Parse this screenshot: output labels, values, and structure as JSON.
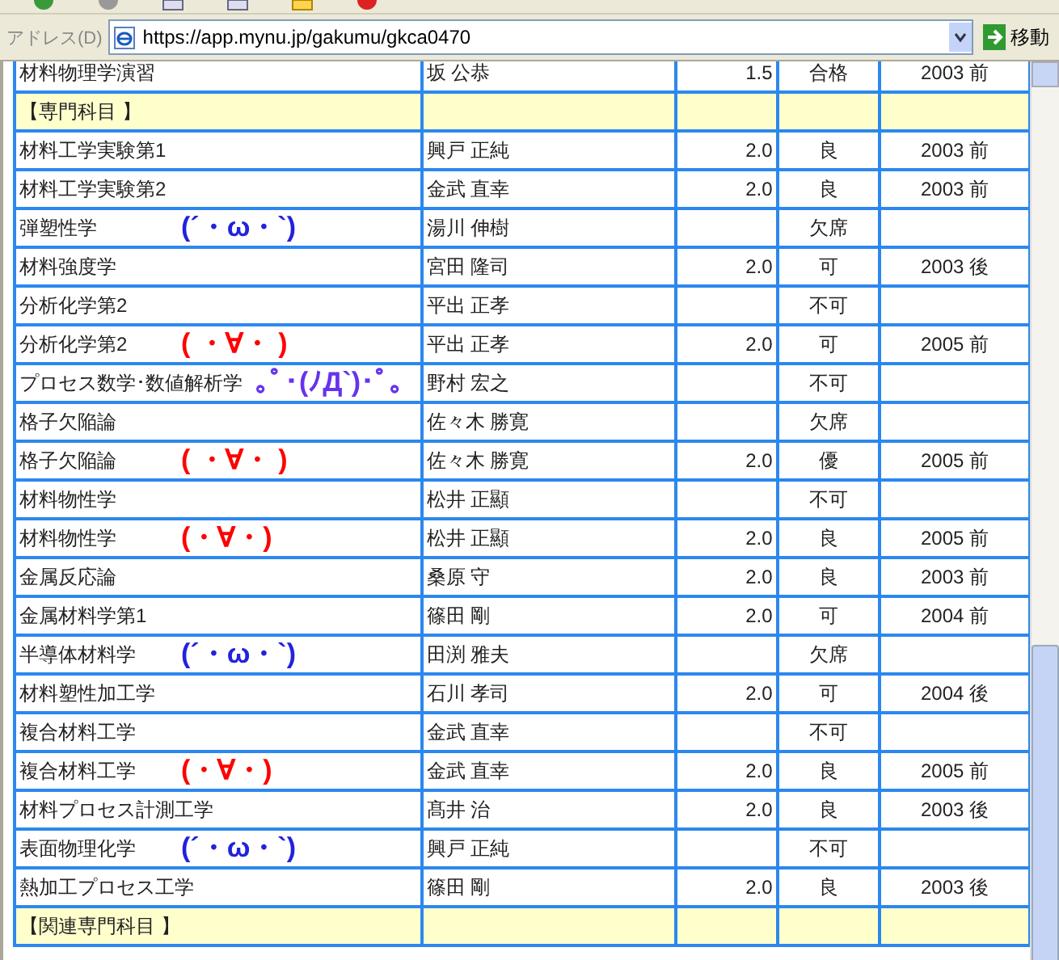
{
  "address_bar": {
    "label": "アドレス(D)",
    "url": "https://app.mynu.jp/gakumu/gkca0470",
    "go_button": "移動"
  },
  "table": {
    "rows": [
      {
        "kind": "course",
        "subject": "材料物理学演習",
        "teacher": "坂 公恭",
        "credits": "1.5",
        "grade": "合格",
        "term": "2003 前"
      },
      {
        "kind": "category",
        "subject": "【専門科目 】"
      },
      {
        "kind": "course",
        "subject": "材料工学実験第1",
        "teacher": "興戸 正純",
        "credits": "2.0",
        "grade": "良",
        "term": "2003 前"
      },
      {
        "kind": "course",
        "subject": "材料工学実験第2",
        "teacher": "金武 直幸",
        "credits": "2.0",
        "grade": "良",
        "term": "2003 前"
      },
      {
        "kind": "course",
        "subject": "弾塑性学",
        "annotation": "(´・ω・`)",
        "color": "#2222dd",
        "teacher": "湯川 伸樹",
        "grade": "欠席"
      },
      {
        "kind": "course",
        "subject": "材料強度学",
        "teacher": "宮田 隆司",
        "credits": "2.0",
        "grade": "可",
        "term": "2003 後"
      },
      {
        "kind": "course",
        "subject": "分析化学第2",
        "teacher": "平出 正孝",
        "grade": "不可"
      },
      {
        "kind": "course",
        "subject": "分析化学第2",
        "annotation": "( ・∀・ )",
        "color": "#ff0000",
        "teacher": "平出 正孝",
        "credits": "2.0",
        "grade": "可",
        "term": "2005 前"
      },
      {
        "kind": "course",
        "subject": "プロセス数学･数値解析学",
        "annotation": "｡ﾟ･(ﾉД`)･ﾟ｡",
        "color": "#6633ee",
        "teacher": "野村 宏之",
        "grade": "不可"
      },
      {
        "kind": "course",
        "subject": "格子欠陥論",
        "teacher": "佐々木 勝寛",
        "grade": "欠席"
      },
      {
        "kind": "course",
        "subject": "格子欠陥論",
        "annotation": "( ・∀・ )",
        "color": "#ff0000",
        "teacher": "佐々木 勝寛",
        "credits": "2.0",
        "grade": "優",
        "term": "2005 前"
      },
      {
        "kind": "course",
        "subject": "材料物性学",
        "teacher": "松井 正顯",
        "grade": "不可"
      },
      {
        "kind": "course",
        "subject": "材料物性学",
        "annotation": "(・∀・)",
        "color": "#ff0000",
        "teacher": "松井 正顯",
        "credits": "2.0",
        "grade": "良",
        "term": "2005 前"
      },
      {
        "kind": "course",
        "subject": "金属反応論",
        "teacher": "桑原 守",
        "credits": "2.0",
        "grade": "良",
        "term": "2003 前"
      },
      {
        "kind": "course",
        "subject": "金属材料学第1",
        "teacher": "篠田 剛",
        "credits": "2.0",
        "grade": "可",
        "term": "2004 前"
      },
      {
        "kind": "course",
        "subject": "半導体材料学",
        "annotation": "(´・ω・`)",
        "color": "#2222dd",
        "teacher": "田渕 雅夫",
        "grade": "欠席"
      },
      {
        "kind": "course",
        "subject": "材料塑性加工学",
        "teacher": "石川 孝司",
        "credits": "2.0",
        "grade": "可",
        "term": "2004 後"
      },
      {
        "kind": "course",
        "subject": "複合材料工学",
        "teacher": "金武 直幸",
        "grade": "不可"
      },
      {
        "kind": "course",
        "subject": "複合材料工学",
        "annotation": "(・∀・)",
        "color": "#ff0000",
        "teacher": "金武 直幸",
        "credits": "2.0",
        "grade": "良",
        "term": "2005 前"
      },
      {
        "kind": "course",
        "subject": "材料プロセス計測工学",
        "teacher": "髙井 治",
        "credits": "2.0",
        "grade": "良",
        "term": "2003 後"
      },
      {
        "kind": "course",
        "subject": "表面物理化学",
        "annotation": "(´・ω・`)",
        "color": "#2222dd",
        "teacher": "興戸 正純",
        "grade": "不可"
      },
      {
        "kind": "course",
        "subject": "熱加工プロセス工学",
        "teacher": "篠田 剛",
        "credits": "2.0",
        "grade": "良",
        "term": "2003 後"
      },
      {
        "kind": "category",
        "subject": "【関連専門科目 】"
      }
    ]
  }
}
